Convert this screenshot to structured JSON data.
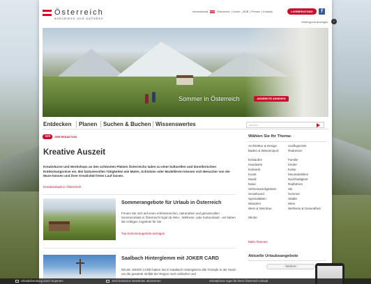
{
  "header": {
    "brand": "Österreich",
    "tagline": "ankommen und aufleben",
    "links": [
      "International",
      "Österreich",
      "Home",
      "B2B",
      "Presse",
      "Kontakt"
    ],
    "live_button": "LIVEBERATUNG",
    "social": "f",
    "background_toggle": "Hintergrund anzeigen"
  },
  "hero": {
    "title": "Sommer in Österreich",
    "button": "ANGEBOTE ANSEHEN"
  },
  "nav": {
    "items": [
      "Entdecken",
      "Planen",
      "Suchen & Buchen",
      "Wissenswertes"
    ],
    "search_placeholder": "suchen"
  },
  "tip": {
    "badge": "TIPP",
    "label": "DER REDAKTION"
  },
  "main": {
    "title": "Kreative Auszeit",
    "lead": "Kreativkurse und Workshops an den schönsten Plätzen Österreichs laden zu einer kulturellen und künstlerischen Entdeckungsreise ein. Bei fantasievollen Tätigkeiten wie Malen, Schnitzen oder Modellieren können sich Besucher von der Muse küssen und ihrer Kreativität freien Lauf lassen.",
    "lead_link": "Kreativurlaub in Österreich",
    "teasers": [
      {
        "title": "Sommerangebote für Urlaub in Österreich",
        "text": "Freuen Sie sich auf einen erlebnisreichen, naturnahen und genussvollen Sommerurlaub in Österreich! Egal ob Aktiv-, Wellness- oder Kultururlaub - wir haben die richtigen Angebote für Sie.",
        "link": "Top Sommerangebote anzeigen"
      },
      {
        "title": "Saalbach Hinterglemm mit JOKER CARD",
        "text": "Mit der JOKER CARD haben Sie in Saalbach Hinterglemm alle Trümpfe in der Hand: um die gesamte Vielfalt der Region noch einfacher und",
        "link": ""
      }
    ]
  },
  "sidebar": {
    "themes_title": "Wählen Sie Ihr Thema:",
    "themes": [
      [
        "Architektur & Design",
        "Ausflugsziele"
      ],
      [
        "Baden & Wassersport",
        "Radreisen"
      ],
      [
        "Einkaufen",
        "Familie"
      ],
      [
        "Handwerk",
        "Kinder"
      ],
      [
        "Kulinarik",
        "Kultur"
      ],
      [
        "Kunst",
        "Mountainbiken"
      ],
      [
        "Musik",
        "Nachhaltigkeit"
      ],
      [
        "Natur",
        "Radfahren"
      ],
      [
        "Sehenswürdigkeiten",
        "Ski"
      ],
      [
        "Snowboard",
        "Sommer"
      ],
      [
        "Spezialitäten",
        "Städte"
      ],
      [
        "Wandern",
        "Wein"
      ],
      [
        "Wein & Weinbau",
        "Wellness & Gesundheit"
      ],
      [
        "Winter",
        ""
      ]
    ],
    "more_themes": "Mehr Themen",
    "offers_title": "Aktuelle Urlaubsangebote",
    "offers_pager": "Weitere"
  },
  "bottom_bar": {
    "items": [
      "Urlaubsberatung durch Experten",
      "Jetzt kostenlos Newsletter abonnieren",
      "Smartphone Apps für Ihren Österreich-Urlaub"
    ]
  },
  "colors": {
    "brand_red": "#c8102e",
    "text": "#333333",
    "facebook": "#3b5998"
  }
}
